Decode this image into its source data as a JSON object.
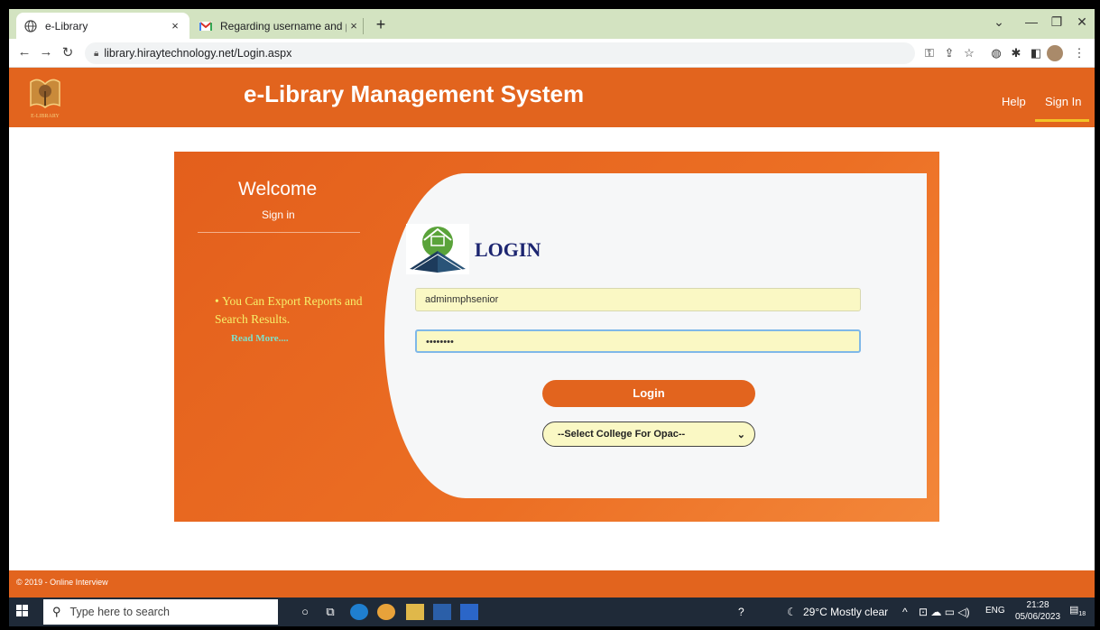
{
  "browser": {
    "tabs": [
      {
        "title": "e-Library",
        "icon": "globe-icon",
        "close": "×"
      },
      {
        "title": "Regarding username and passwo",
        "icon": "gmail-icon",
        "close": "×"
      }
    ],
    "new_tab": "+",
    "url": "library.hiraytechnology.net/Login.aspx"
  },
  "site": {
    "logo_text": "E-LIBRARY",
    "title": "e-Library Management System",
    "nav": [
      {
        "label": "Help"
      },
      {
        "label": "Sign In"
      }
    ],
    "accent_color": "#e2641e",
    "highlight_color": "#f3c327"
  },
  "welcome": {
    "heading": "Welcome",
    "subheading": "Sign in",
    "bullet": "You Can Export Reports and Search Results.",
    "read_more": "Read More...."
  },
  "login": {
    "title": "LOGIN",
    "username_value": "adminmphsenior",
    "password_value": "••••••••",
    "button_label": "Login",
    "college_select": "--Select College For Opac--"
  },
  "footer": {
    "text": "© 2019 - Online Interview"
  },
  "taskbar": {
    "search_placeholder": "Type here to search",
    "weather": "29°C  Mostly clear",
    "language": "ENG",
    "time": "21:28",
    "date": "05/06/2023",
    "notifications": "18"
  }
}
